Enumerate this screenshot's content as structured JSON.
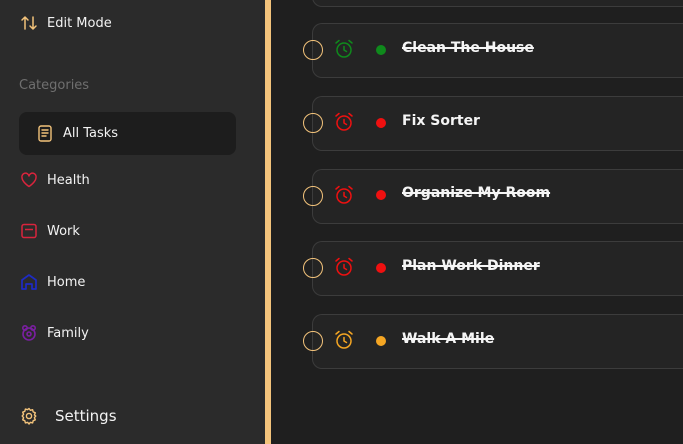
{
  "sidebar": {
    "edit_mode": {
      "label": "Edit Mode",
      "icon": "sort-arrows-icon"
    },
    "categories_title": "Categories",
    "items": [
      {
        "label": "All Tasks",
        "icon": "task-list-icon",
        "color": "#f3c37b",
        "active": true
      },
      {
        "label": "Health",
        "icon": "heart-icon",
        "color": "#d9243d"
      },
      {
        "label": "Work",
        "icon": "briefcase-icon",
        "color": "#d9243d"
      },
      {
        "label": "Home",
        "icon": "house-icon",
        "color": "#1e2bc4"
      },
      {
        "label": "Family",
        "icon": "family-icon",
        "color": "#7b1fa2"
      }
    ],
    "settings": {
      "label": "Settings",
      "icon": "gear-icon"
    }
  },
  "accent": "#f3c37b",
  "tasks": [
    {
      "title": "Clean The House",
      "priority_color": "#0f8a1c",
      "alarm_color": "#0f8a1c",
      "completed": true
    },
    {
      "title": "Fix Sorter",
      "priority_color": "#ef1010",
      "alarm_color": "#ef1010",
      "completed": false
    },
    {
      "title": "Organize My Room",
      "priority_color": "#ef1010",
      "alarm_color": "#ef1010",
      "completed": true
    },
    {
      "title": "Plan Work Dinner",
      "priority_color": "#ef1010",
      "alarm_color": "#ef1010",
      "completed": true
    },
    {
      "title": "Walk A Mile",
      "priority_color": "#f5a623",
      "alarm_color": "#f5a623",
      "completed": true
    }
  ]
}
